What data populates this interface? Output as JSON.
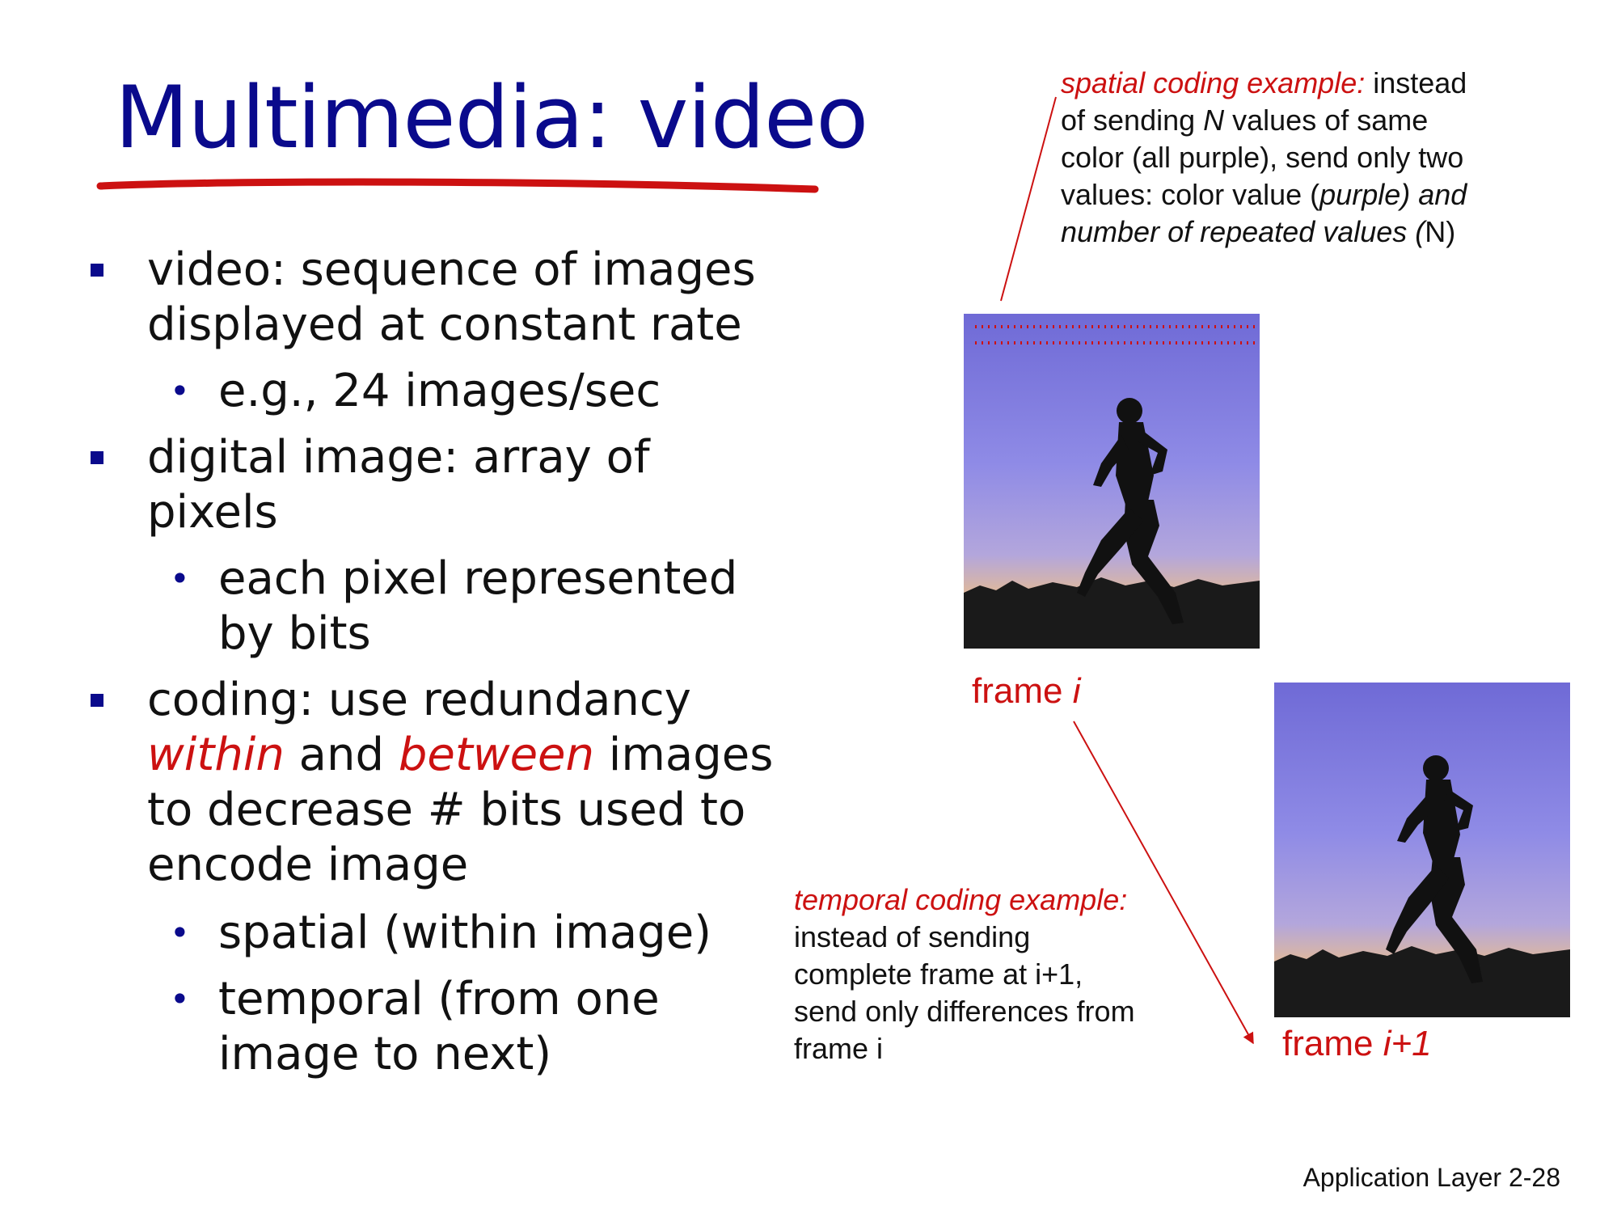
{
  "title": "Multimedia: video",
  "bullets": {
    "b1_line1": "video: sequence of images",
    "b1_line2": "displayed at constant rate",
    "b1_sub1": "e.g., 24 images/sec",
    "b2_line1": "digital image: array of pixels",
    "b2_sub1_line1": "each pixel represented",
    "b2_sub1_line2": "by bits",
    "b3_line1": "coding: use redundancy",
    "b3_within": "within",
    "b3_and": " and ",
    "b3_between": "between",
    "b3_images": " images",
    "b3_line3": "to decrease # bits used to",
    "b3_line4": "encode image",
    "b3_sub1": "spatial (within image)",
    "b3_sub2_line1": "temporal (from one",
    "b3_sub2_line2": "image to next)"
  },
  "spatial_note": {
    "lead": "spatial coding example:",
    "part1": " instead",
    "part2": "of sending ",
    "n1": "N",
    "part3": " values of same",
    "line3": "color (all purple), send only two",
    "part4": "values: color  value (",
    "purple": "purple)  and",
    "line5": "number of repeated values (",
    "n2": "N)"
  },
  "temporal_note": {
    "lead": "temporal coding example:",
    "line2": "instead of sending",
    "line3": "complete frame at i+1,",
    "line4": "send only differences from",
    "line5": "frame i"
  },
  "frame_i": {
    "prefix": "frame ",
    "var": "i"
  },
  "frame_i1": {
    "prefix": "frame ",
    "var": "i+1"
  },
  "footer": "Application Layer 2-28",
  "colors": {
    "title_blue": "#0a0a8c",
    "accent_red": "#cc1111",
    "sky_purple": "#8a86e0"
  }
}
